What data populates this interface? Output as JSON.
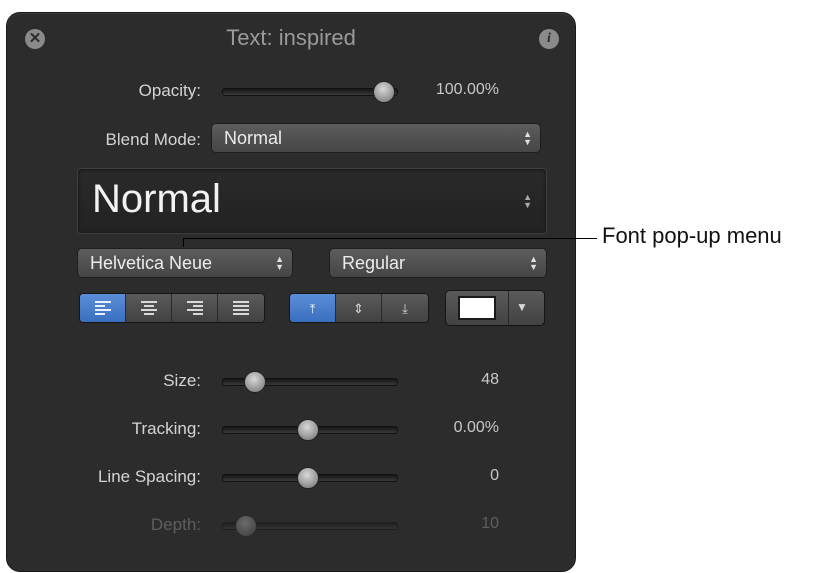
{
  "window": {
    "title": "Text: inspired"
  },
  "opacity": {
    "label": "Opacity:",
    "value": "100.00%",
    "level": 1.0
  },
  "blend_mode": {
    "label": "Blend Mode:",
    "selected": "Normal"
  },
  "font_preview": {
    "text": "Normal"
  },
  "font_family": {
    "selected": "Helvetica Neue"
  },
  "font_style": {
    "selected": "Regular"
  },
  "horizontal_alignment": {
    "options": [
      "left",
      "center",
      "right",
      "justify"
    ],
    "selected": "left"
  },
  "vertical_alignment": {
    "options": [
      "top",
      "middle",
      "bottom"
    ],
    "selected": "top"
  },
  "text_color": {
    "hex": "#ffffff"
  },
  "size": {
    "label": "Size:",
    "value": "48",
    "level": 0.18
  },
  "tracking": {
    "label": "Tracking:",
    "value": "0.00%",
    "level": 0.5
  },
  "line_spacing": {
    "label": "Line Spacing:",
    "value": "0",
    "level": 0.5
  },
  "depth": {
    "label": "Depth:",
    "value": "10",
    "level": 0.12,
    "enabled": false
  },
  "annotation": {
    "callout": "Font pop-up menu"
  },
  "colors": {
    "panel_bg": "#2c2c2c",
    "accent": "#4a7fcf"
  }
}
